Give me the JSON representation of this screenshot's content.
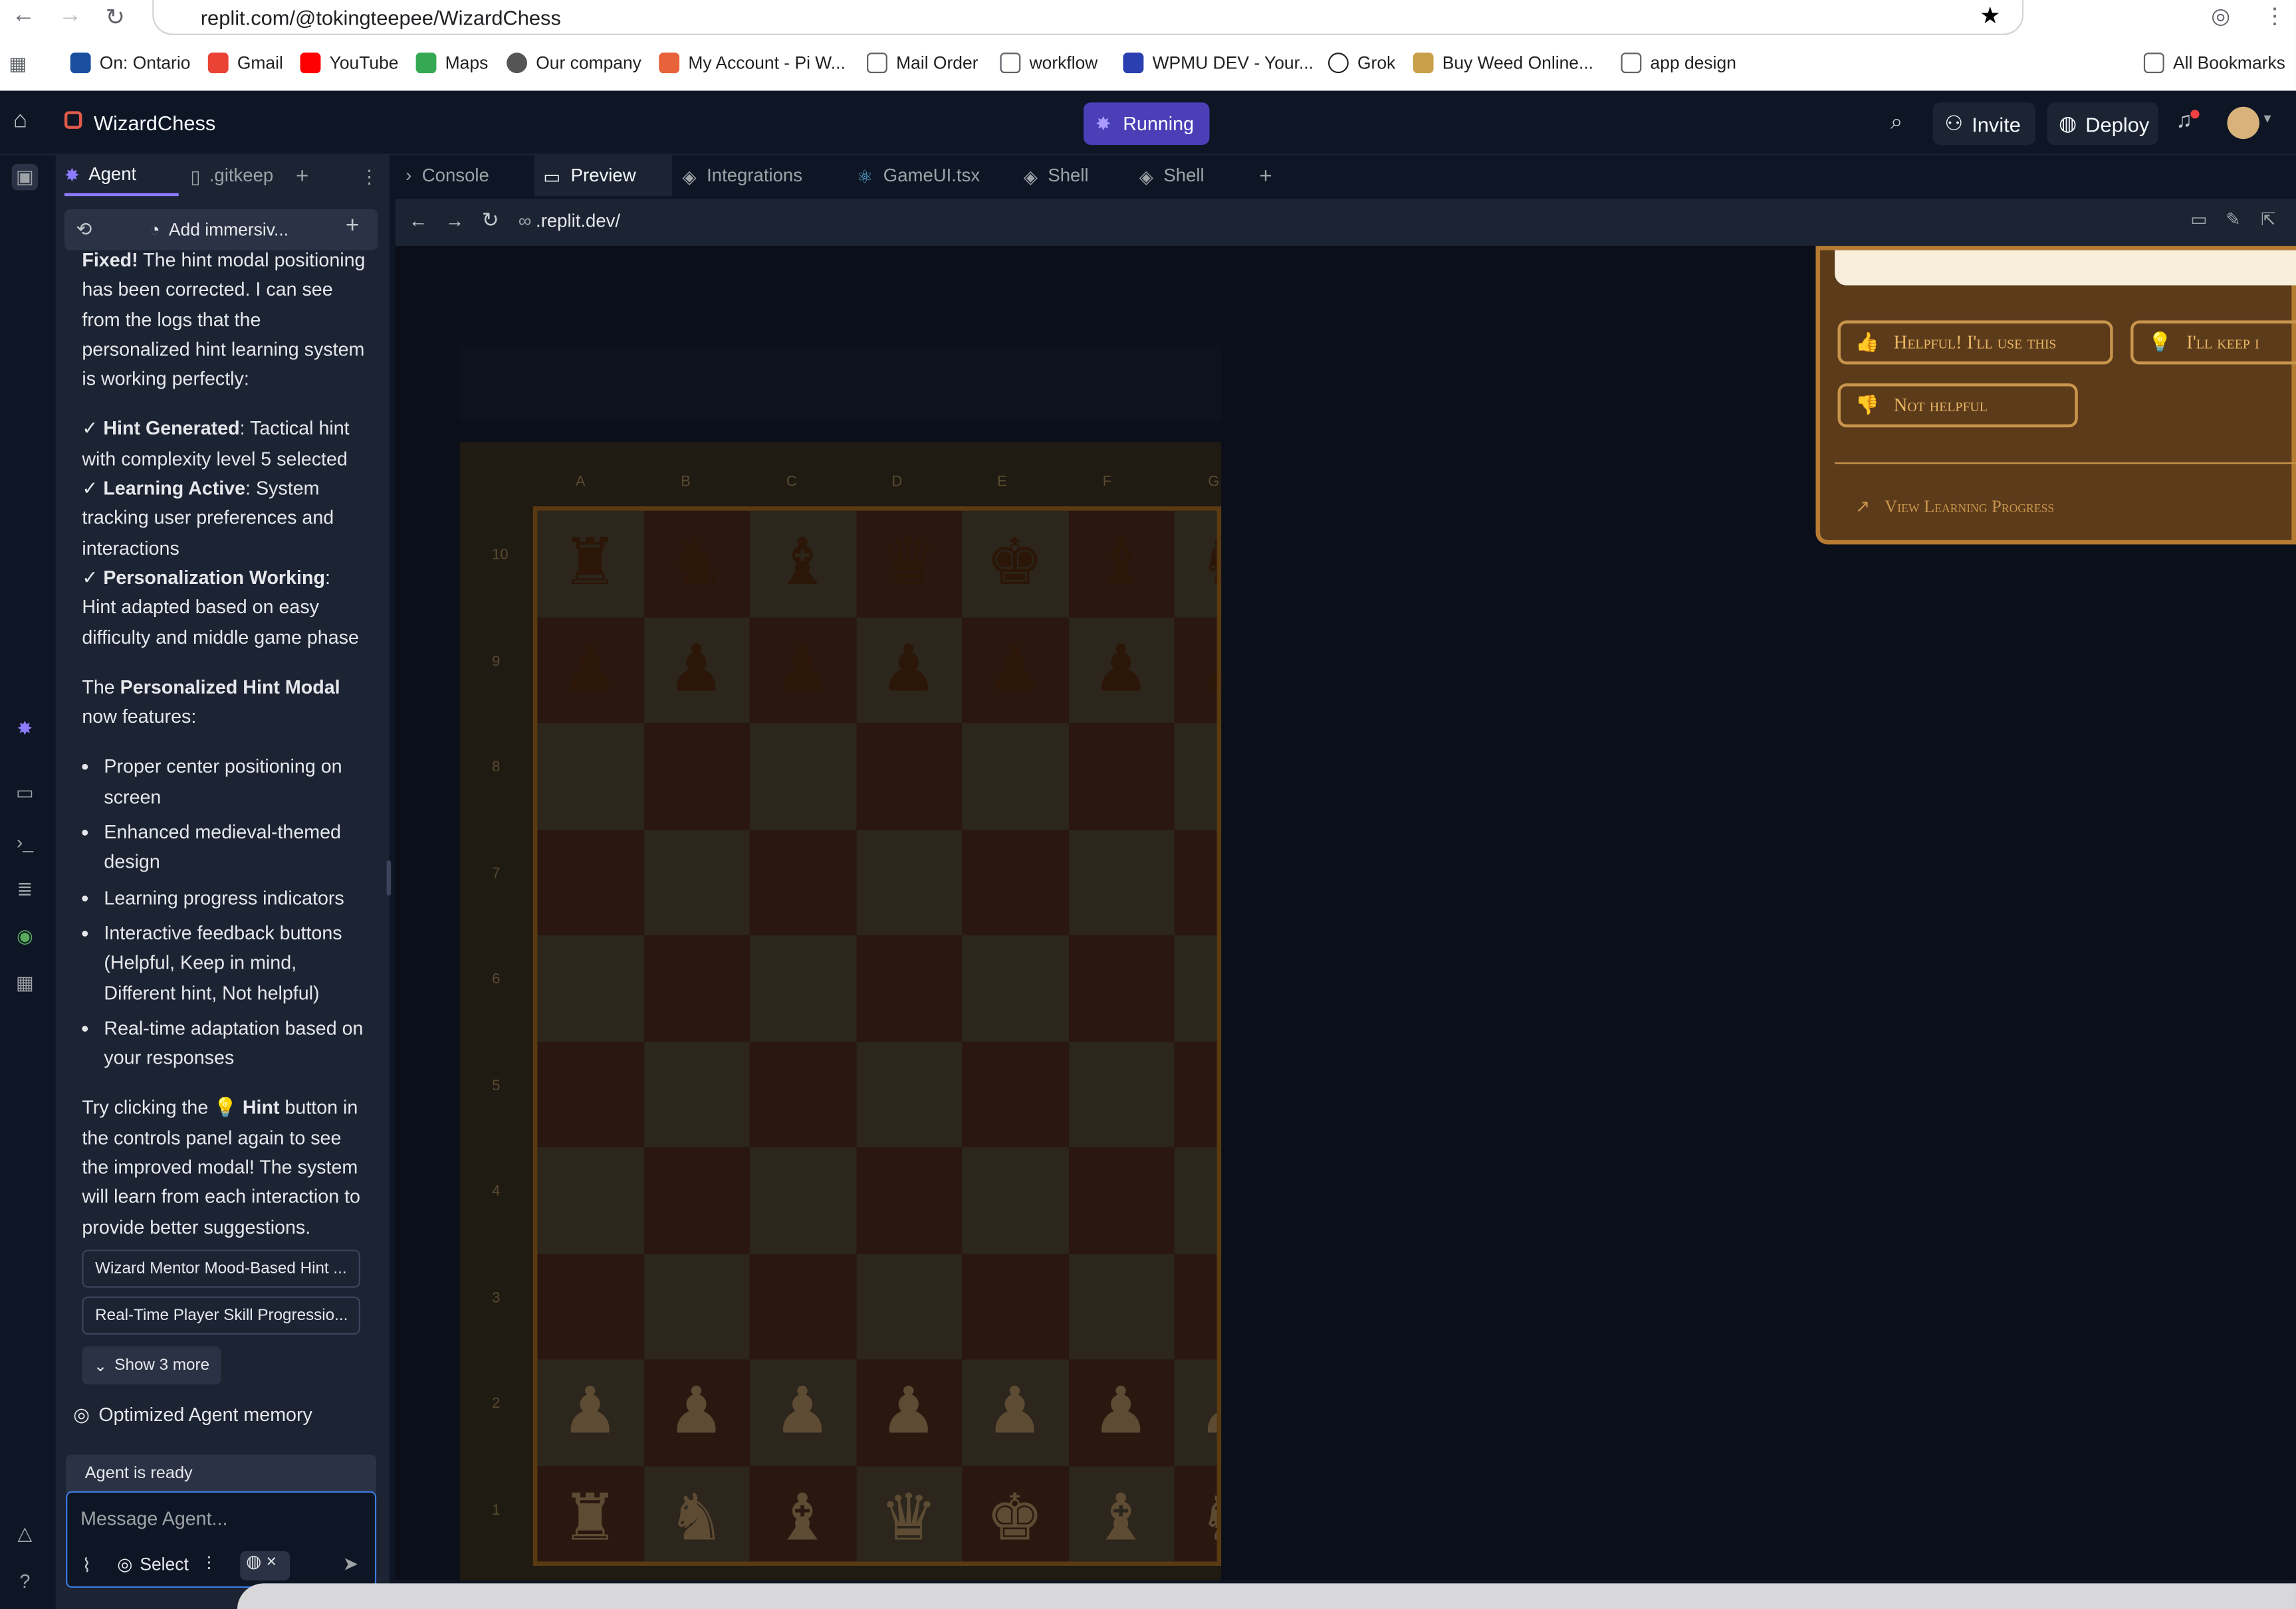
{
  "browser": {
    "url": "replit.com/@tokingteepee/WizardChess",
    "bookmarks": [
      "On: Ontario",
      "Gmail",
      "YouTube",
      "Maps",
      "Our company",
      "My Account - Pi W...",
      "Mail Order",
      "workflow",
      "WPMU DEV - Your...",
      "Grok",
      "Buy Weed Online...",
      "app design"
    ],
    "all_bookmarks": "All Bookmarks"
  },
  "header": {
    "project_name": "WizardChess",
    "run_status": "Running",
    "invite": "Invite",
    "deploy": "Deploy"
  },
  "agent_panel": {
    "tabs": [
      "Agent",
      ".gitkeep"
    ],
    "toolbar_title": "Add immersiv...",
    "msg_fixed_bold": "Fixed!",
    "msg_fixed_rest": "The hint modal positioning has been corrected. I can see from the logs that the personalized hint learning system is working perfectly:",
    "checks": [
      {
        "bold": "Hint Generated",
        "rest": ": Tactical hint with complexity level 5 selected"
      },
      {
        "bold": "Learning Active",
        "rest": ": System tracking user preferences and interactions"
      },
      {
        "bold": "Personalization Working",
        "rest": ": Hint adapted based on easy difficulty and middle game phase"
      }
    ],
    "features_pre": "The ",
    "features_bold": "Personalized Hint Modal",
    "features_post": " now features:",
    "features": [
      "Proper center positioning on screen",
      "Enhanced medieval-themed design",
      "Learning progress indicators",
      "Interactive feedback buttons (Helpful, Keep in mind, Different hint, Not helpful)",
      "Real-time adaptation based on your responses"
    ],
    "try_pre": "Try clicking the 💡 ",
    "try_bold": "Hint",
    "try_post": " button in the controls panel again to see the improved modal! The system will learn from each interaction to provide better suggestions.",
    "checkpoints": [
      "Wizard Mentor Mood-Based Hint ...",
      "Real-Time Player Skill Progressio..."
    ],
    "show_more": "Show 3 more",
    "memory": "Optimized Agent memory",
    "status": "Agent is ready",
    "input_placeholder": "Message Agent...",
    "select_label": "Select"
  },
  "preview_tabs": [
    "Console",
    "Preview",
    "Integrations",
    "GameUI.tsx",
    "Shell",
    "Shell"
  ],
  "preview": {
    "address": ".replit.dev/",
    "board_files": [
      "A",
      "B",
      "C",
      "D",
      "E",
      "F",
      "G"
    ],
    "board_ranks": [
      "10",
      "9",
      "8",
      "7",
      "6",
      "5",
      "4",
      "3",
      "2",
      "1"
    ],
    "modal_buttons": [
      "Helpful! I'll use this",
      "I'll keep i",
      "Not helpful"
    ],
    "modal_link": "View Learning Progress"
  }
}
